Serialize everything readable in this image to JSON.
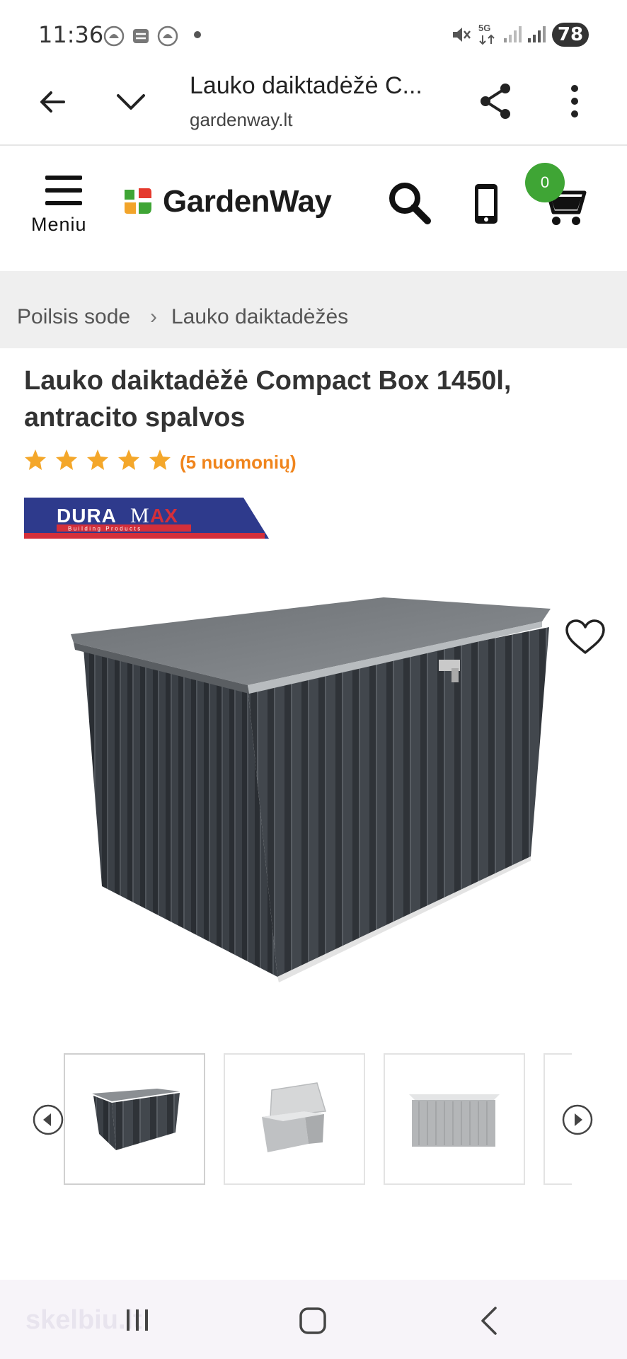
{
  "status_bar": {
    "time": "11:36",
    "battery": "78"
  },
  "browser": {
    "title": "Lauko daiktadėžė C...",
    "domain": "gardenway.lt"
  },
  "header": {
    "menu_label": "Meniu",
    "logo_text": "GardenWay",
    "cart_count": "0"
  },
  "breadcrumb": {
    "items": [
      "Poilsis sode",
      "Lauko daiktadėžės"
    ],
    "separator": "›"
  },
  "product": {
    "title": "Lauko daiktadėžė Compact Box 1450l, antracito spalvos",
    "rating_stars": 5,
    "reviews_text": "(5 nuomonių)",
    "brand_logo_text": "DURAMAX",
    "brand_logo_subtext": "Building Products"
  },
  "navbar": {
    "watermark": "skelbiu.lt"
  },
  "colors": {
    "accent_green": "#3fa535",
    "rating_orange": "#f0851d",
    "star": "#f4a72a",
    "brand_blue": "#2e3a8c",
    "brand_red": "#d42f3a"
  }
}
